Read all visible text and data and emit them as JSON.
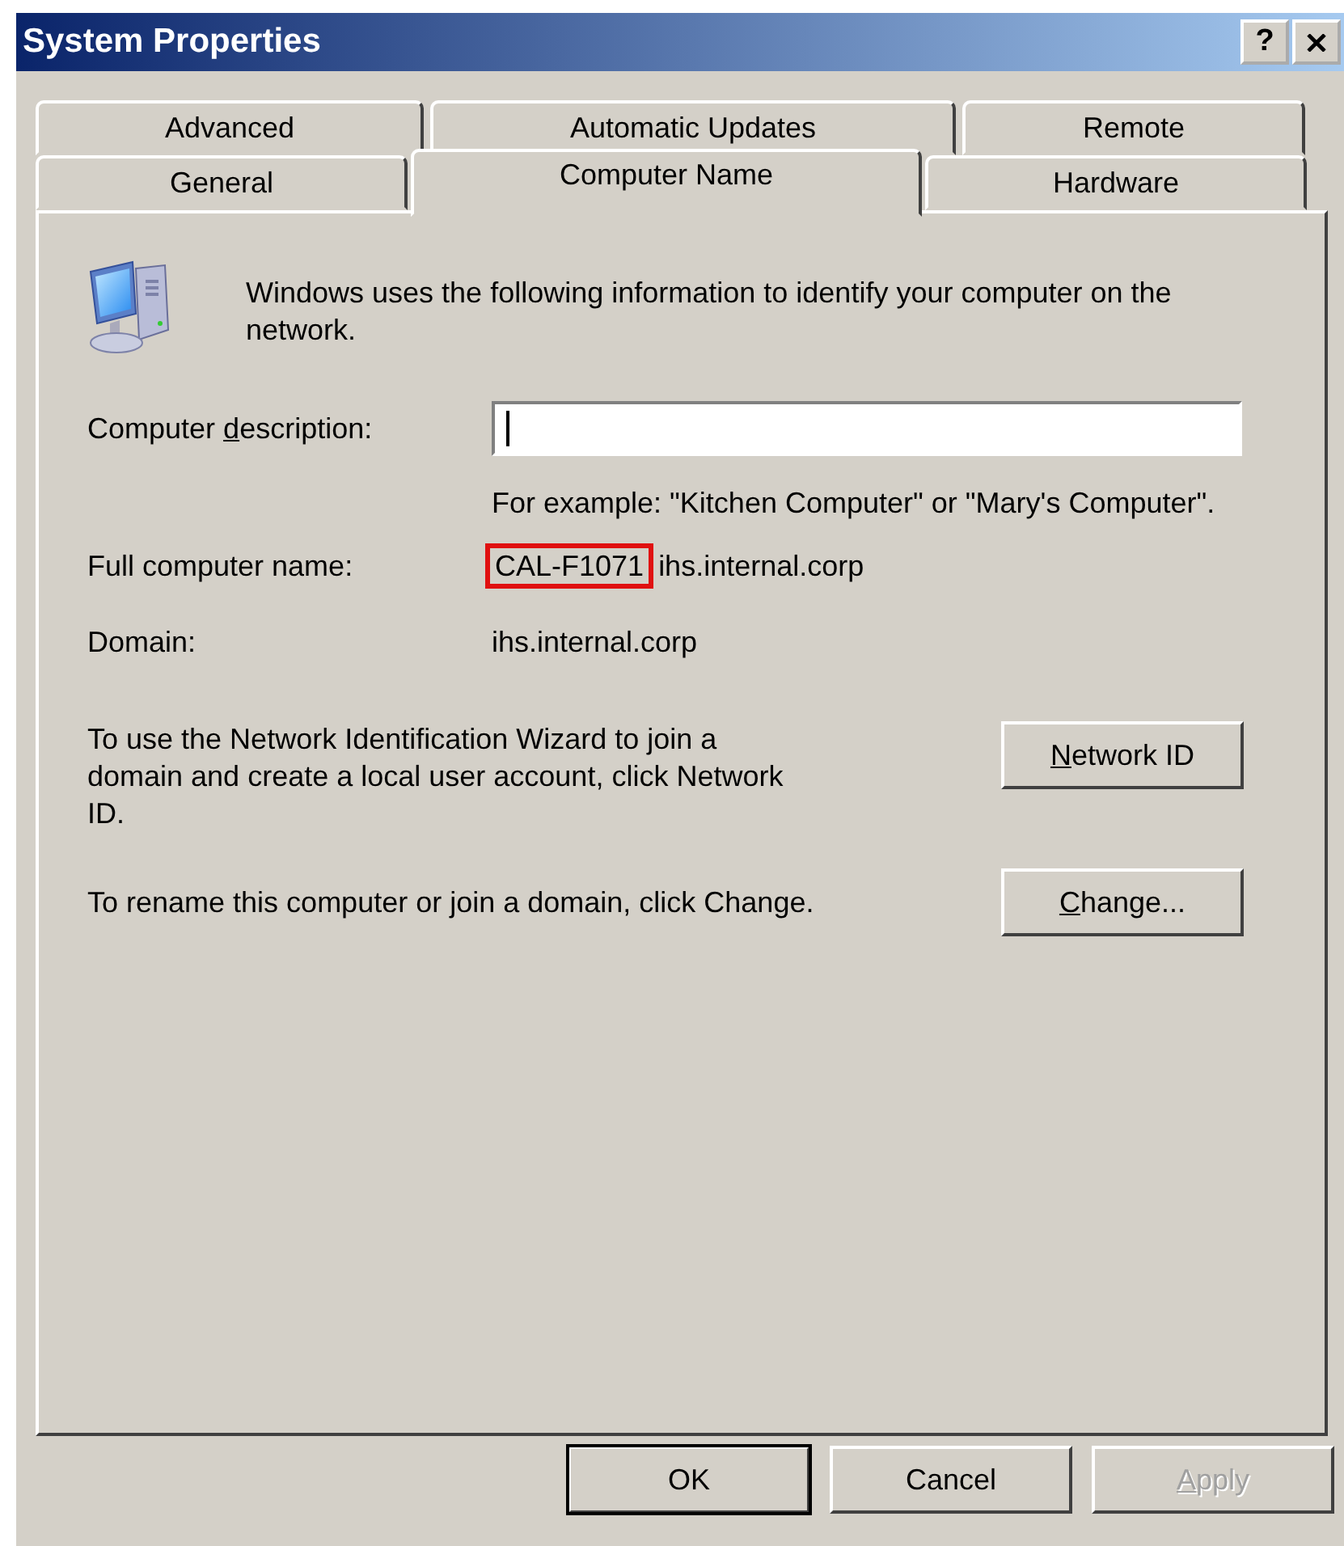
{
  "window": {
    "title": "System Properties",
    "help": "?"
  },
  "tab_rows": [
    {
      "tabs": [
        {
          "label": "Advanced",
          "selected": false
        },
        {
          "label": "Automatic Updates",
          "selected": false
        },
        {
          "label": "Remote",
          "selected": false
        }
      ]
    },
    {
      "tabs": [
        {
          "label": "General",
          "selected": false
        },
        {
          "label": "Computer Name",
          "selected": true
        },
        {
          "label": "Hardware",
          "selected": false
        }
      ]
    }
  ],
  "intro": "Windows uses the following information to identify your computer on the network.",
  "description": {
    "label": {
      "before": "Computer ",
      "key": "d",
      "after": "escription:"
    }
  },
  "example": "For example: \"Kitchen Computer\" or \"Mary's Computer\".",
  "full_name": {
    "label": "Full computer name:",
    "parts": [
      {
        "text": "CAL-F1071",
        "highlighted": true
      },
      {
        "text": "ihs.internal.corp",
        "highlighted": false
      }
    ]
  },
  "domain": {
    "label": "Domain:",
    "value": "ihs.internal.corp"
  },
  "actions": [
    {
      "text": "To use the Network Identification Wizard to join a domain and create a local user account, click Network ID.",
      "button": {
        "key": "N",
        "after": "etwork ID"
      }
    },
    {
      "text": "To rename this computer or join a domain, click Change.",
      "button": {
        "key": "C",
        "after": "hange..."
      }
    }
  ],
  "buttons": [
    {
      "label": {
        "before": "OK"
      },
      "default": true,
      "disabled": false
    },
    {
      "label": {
        "before": "Cancel"
      },
      "default": false,
      "disabled": false
    },
    {
      "label": {
        "key": "A",
        "after": "pply"
      },
      "default": false,
      "disabled": true
    }
  ]
}
